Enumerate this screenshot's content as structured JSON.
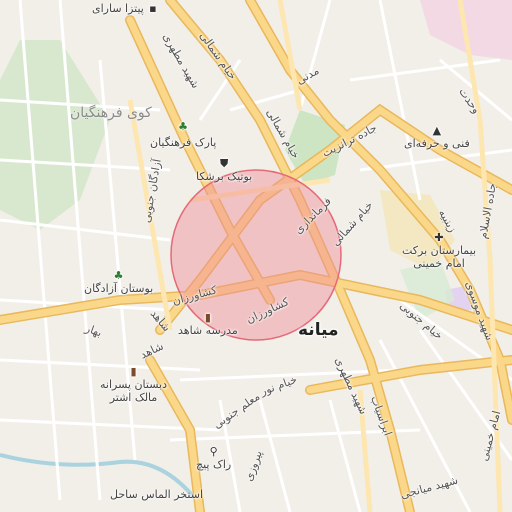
{
  "map": {
    "city": "میانه",
    "district": "کوی فرهنگیان",
    "highlight_color": "#f08c96",
    "road_color": "#fbd889",
    "road_edge_color": "#e8b85c",
    "park_color": "#cde5c3",
    "hospital_area_color": "#f3d9e4",
    "land_color": "#f2efe9"
  },
  "streets": {
    "shomali": "خیام شمالی",
    "jonubi": "خیام جنوبی",
    "tranzit": "جاده ترانزیت",
    "mozaffari": "شهید مطهری",
    "farmandari": "فرمانداری",
    "keshavarzan1": "کشاورزان",
    "keshavarzan2": "کشاورزان",
    "azadegan": "آزادگان جنوبی",
    "bahar": "بهار",
    "shahed": "شاهد",
    "madani": "مدنی",
    "vahdat": "وحدت",
    "zeinabieh": "زینبیه",
    "shahid_mousavi": "شهید موسوی",
    "imam_khomeini": "امام خمینی",
    "nur": "خیام نور",
    "motahari2": "شهید مطهری",
    "moallem": "معلم جنوبی",
    "abrasiab": "ابراسیاب",
    "piroozi": "پیروزی",
    "shahid_mianeh": "شهید میانجی",
    "alhadi": "جاده الاسلام"
  },
  "pois": {
    "pizza": "پیتزا سارای",
    "park": "پارک فرهنگیان",
    "boutique": "بوتیک برشکا",
    "boostan": "بوستان آزادگان",
    "madrese": "مدرسه شاهد",
    "dabestan": "دبستان پسرانه\nمالک اشتر",
    "hospital": "بیمارستان برکت\nامام خمینی",
    "fanni": "فنی و حرفه‌ای",
    "rakpich": "راک پیچ",
    "pool": "استخر الماس ساحل"
  },
  "icons": {
    "park": "tree-icon",
    "boutique": "clothes-icon",
    "boostan": "tree-icon",
    "madrese": "school-icon",
    "dabestan": "school-icon",
    "hospital": "hospital-icon",
    "fanni": "college-icon",
    "rakpich": "shop-icon"
  }
}
